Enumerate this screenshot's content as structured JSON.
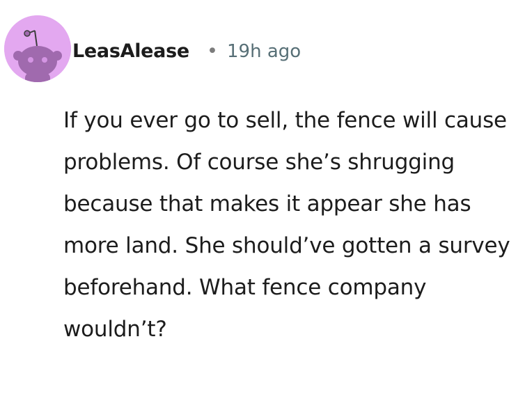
{
  "comment": {
    "author": "LeasAlease",
    "separator": "•",
    "timestamp": "19h ago",
    "avatar_icon": "snoo-avatar-icon",
    "avatar_color": "#e3a8f0",
    "body": "If you ever go to sell, the fence will cause problems. Of course she’s shrugging because that makes it appear she has more land. She should’ve gotten a survey beforehand. What fence company wouldn’t?"
  }
}
